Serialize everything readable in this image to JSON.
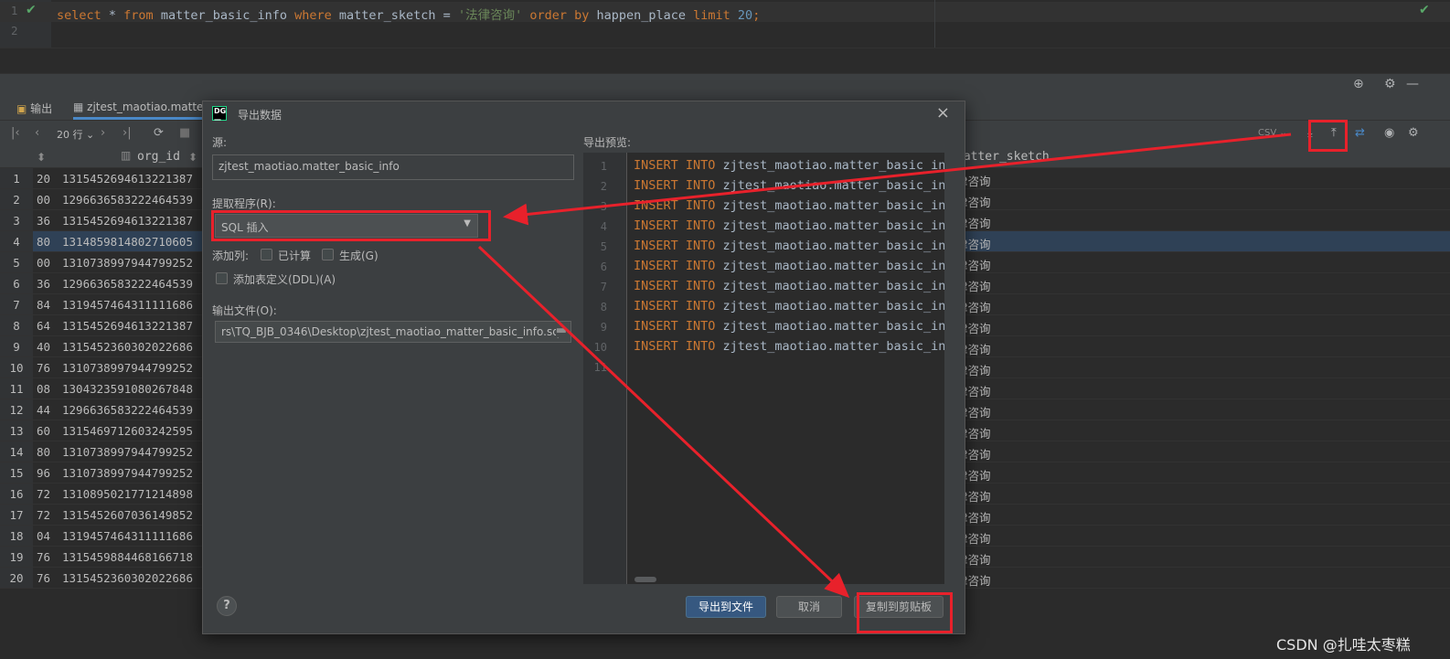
{
  "editor": {
    "line_numbers": [
      "1",
      "2"
    ],
    "sql_tokens": [
      {
        "t": "select",
        "c": "kw"
      },
      {
        "t": " * ",
        "c": "id"
      },
      {
        "t": "from",
        "c": "kw"
      },
      {
        "t": " matter_basic_info ",
        "c": "id"
      },
      {
        "t": "where",
        "c": "kw"
      },
      {
        "t": " matter_sketch = ",
        "c": "id"
      },
      {
        "t": "'法律咨询'",
        "c": "str"
      },
      {
        "t": " order by",
        "c": "kw"
      },
      {
        "t": " happen_place ",
        "c": "id"
      },
      {
        "t": "limit",
        "c": "kw"
      },
      {
        "t": " 20",
        "c": "num"
      },
      {
        "t": ";",
        "c": "kw"
      }
    ]
  },
  "tabs": {
    "output": "输出",
    "result": "zjtest_maotiao.matter_b"
  },
  "toolbar": {
    "rows": "20 行",
    "format": "CSV"
  },
  "grid": {
    "col_org_id": "org_id",
    "col_matter_sketch": "matter_sketch",
    "rows": [
      {
        "n": "1",
        "a": "20",
        "b": "1315452694613221387",
        "c": "律咨询"
      },
      {
        "n": "2",
        "a": "00",
        "b": "1296636583222464539",
        "c": "律咨询"
      },
      {
        "n": "3",
        "a": "36",
        "b": "1315452694613221387",
        "c": "律咨询"
      },
      {
        "n": "4",
        "a": "80",
        "b": "1314859814802710605",
        "c": "律咨询"
      },
      {
        "n": "5",
        "a": "00",
        "b": "1310738997944799252",
        "c": "律咨询"
      },
      {
        "n": "6",
        "a": "36",
        "b": "1296636583222464539",
        "c": "律咨询"
      },
      {
        "n": "7",
        "a": "84",
        "b": "1319457464311111686",
        "c": "律咨询"
      },
      {
        "n": "8",
        "a": "64",
        "b": "1315452694613221387",
        "c": "律咨询"
      },
      {
        "n": "9",
        "a": "40",
        "b": "1315452360302022686",
        "c": "律咨询"
      },
      {
        "n": "10",
        "a": "76",
        "b": "1310738997944799252",
        "c": "律咨询"
      },
      {
        "n": "11",
        "a": "08",
        "b": "1304323591080267848",
        "c": "律咨询"
      },
      {
        "n": "12",
        "a": "44",
        "b": "1296636583222464539",
        "c": "律咨询"
      },
      {
        "n": "13",
        "a": "60",
        "b": "1315469712603242595",
        "c": "律咨询"
      },
      {
        "n": "14",
        "a": "80",
        "b": "1310738997944799252",
        "c": "律咨询"
      },
      {
        "n": "15",
        "a": "96",
        "b": "1310738997944799252",
        "c": "律咨询"
      },
      {
        "n": "16",
        "a": "72",
        "b": "1310895021771214898",
        "c": "律咨询"
      },
      {
        "n": "17",
        "a": "72",
        "b": "1315452607036149852",
        "c": "律咨询"
      },
      {
        "n": "18",
        "a": "04",
        "b": "1319457464311111686",
        "c": "律咨询"
      },
      {
        "n": "19",
        "a": "76",
        "b": "1315459884468166718",
        "c": "律咨询"
      },
      {
        "n": "20",
        "a": "76",
        "b": "1315452360302022686",
        "c": "律咨询"
      }
    ]
  },
  "dialog": {
    "title": "导出数据",
    "source_label": "源:",
    "source_value": "zjtest_maotiao.matter_basic_info",
    "extractor_label": "提取程序(R):",
    "extractor_value": "SQL 插入",
    "add_columns_label": "添加列:",
    "computed_label": "已计算",
    "generated_label": "生成(G)",
    "add_ddl_label": "添加表定义(DDL)(A)",
    "output_file_label": "输出文件(O):",
    "output_file_value": "rs\\TQ_BJB_0346\\Desktop\\zjtest_maotiao_matter_basic_info.sql",
    "preview_label": "导出预览:",
    "preview_lines": [
      "1",
      "2",
      "3",
      "4",
      "5",
      "6",
      "7",
      "8",
      "9",
      "10",
      "11"
    ],
    "preview_kw": "INSERT INTO",
    "preview_table": " zjtest_maotiao.matter_basic_inf",
    "export_to_file": "导出到文件",
    "cancel": "取消",
    "copy_to_clipboard": "复制到剪贴板",
    "help": "?"
  },
  "watermark": "CSDN @扎哇太枣糕",
  "colors": {
    "annotation_red": "#e8212b",
    "primary_button": "#365880"
  }
}
